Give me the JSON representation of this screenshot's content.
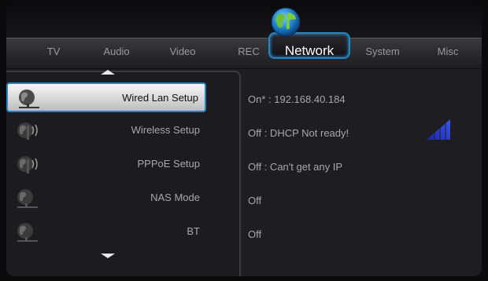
{
  "tabs": [
    {
      "label": "TV"
    },
    {
      "label": "Audio"
    },
    {
      "label": "Video"
    },
    {
      "label": "REC"
    },
    {
      "label": "Network"
    },
    {
      "label": "System"
    },
    {
      "label": "Misc"
    }
  ],
  "active_tab": "Network",
  "menu": {
    "items": [
      {
        "label": "Wired Lan Setup",
        "icon": "wired-lan-icon",
        "status": "On* : 192.168.40.184",
        "selected": true
      },
      {
        "label": "Wireless Setup",
        "icon": "wireless-icon",
        "status": "Off : DHCP Not ready!",
        "selected": false
      },
      {
        "label": "PPPoE Setup",
        "icon": "wireless-icon",
        "status": "Off : Can't get any IP",
        "selected": false
      },
      {
        "label": "NAS Mode",
        "icon": "network-globe-icon",
        "status": "Off",
        "selected": false
      },
      {
        "label": "BT",
        "icon": "network-globe-icon",
        "status": "Off",
        "selected": false
      }
    ]
  },
  "colors": {
    "accent": "#1f86c9",
    "signal": "#2a3fd0"
  }
}
